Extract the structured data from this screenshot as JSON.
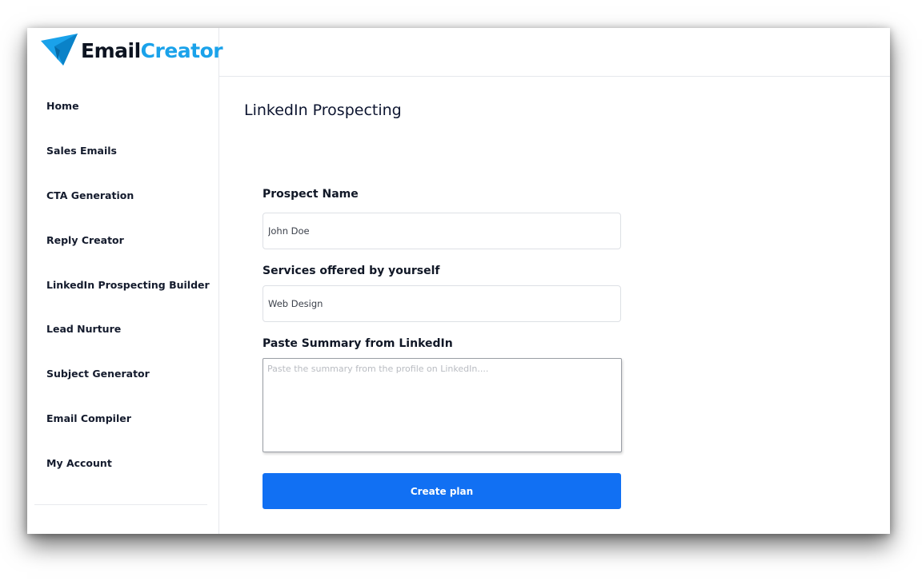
{
  "app": {
    "logo_part1": "Email",
    "logo_part2": "Creator",
    "logo_icon": "paper-plane-icon",
    "brand_colors": {
      "dark": "#0c1320",
      "accent": "#1aa2ea",
      "button": "#1170f3"
    }
  },
  "sidebar": {
    "items": [
      {
        "label": "Home"
      },
      {
        "label": "Sales Emails"
      },
      {
        "label": "CTA Generation"
      },
      {
        "label": "Reply Creator"
      },
      {
        "label": "LinkedIn Prospecting Builder"
      },
      {
        "label": "Lead Nurture"
      },
      {
        "label": "Subject Generator"
      },
      {
        "label": "Email Compiler"
      },
      {
        "label": "My Account"
      }
    ]
  },
  "main": {
    "title": "LinkedIn Prospecting",
    "form": {
      "prospect_name": {
        "label": "Prospect Name",
        "value": "John Doe"
      },
      "services": {
        "label": "Services offered by yourself",
        "value": "Web Design"
      },
      "summary": {
        "label": "Paste Summary from LinkedIn",
        "value": "",
        "placeholder": "Paste the summary from the profile on LinkedIn...."
      },
      "submit_label": "Create plan"
    }
  }
}
